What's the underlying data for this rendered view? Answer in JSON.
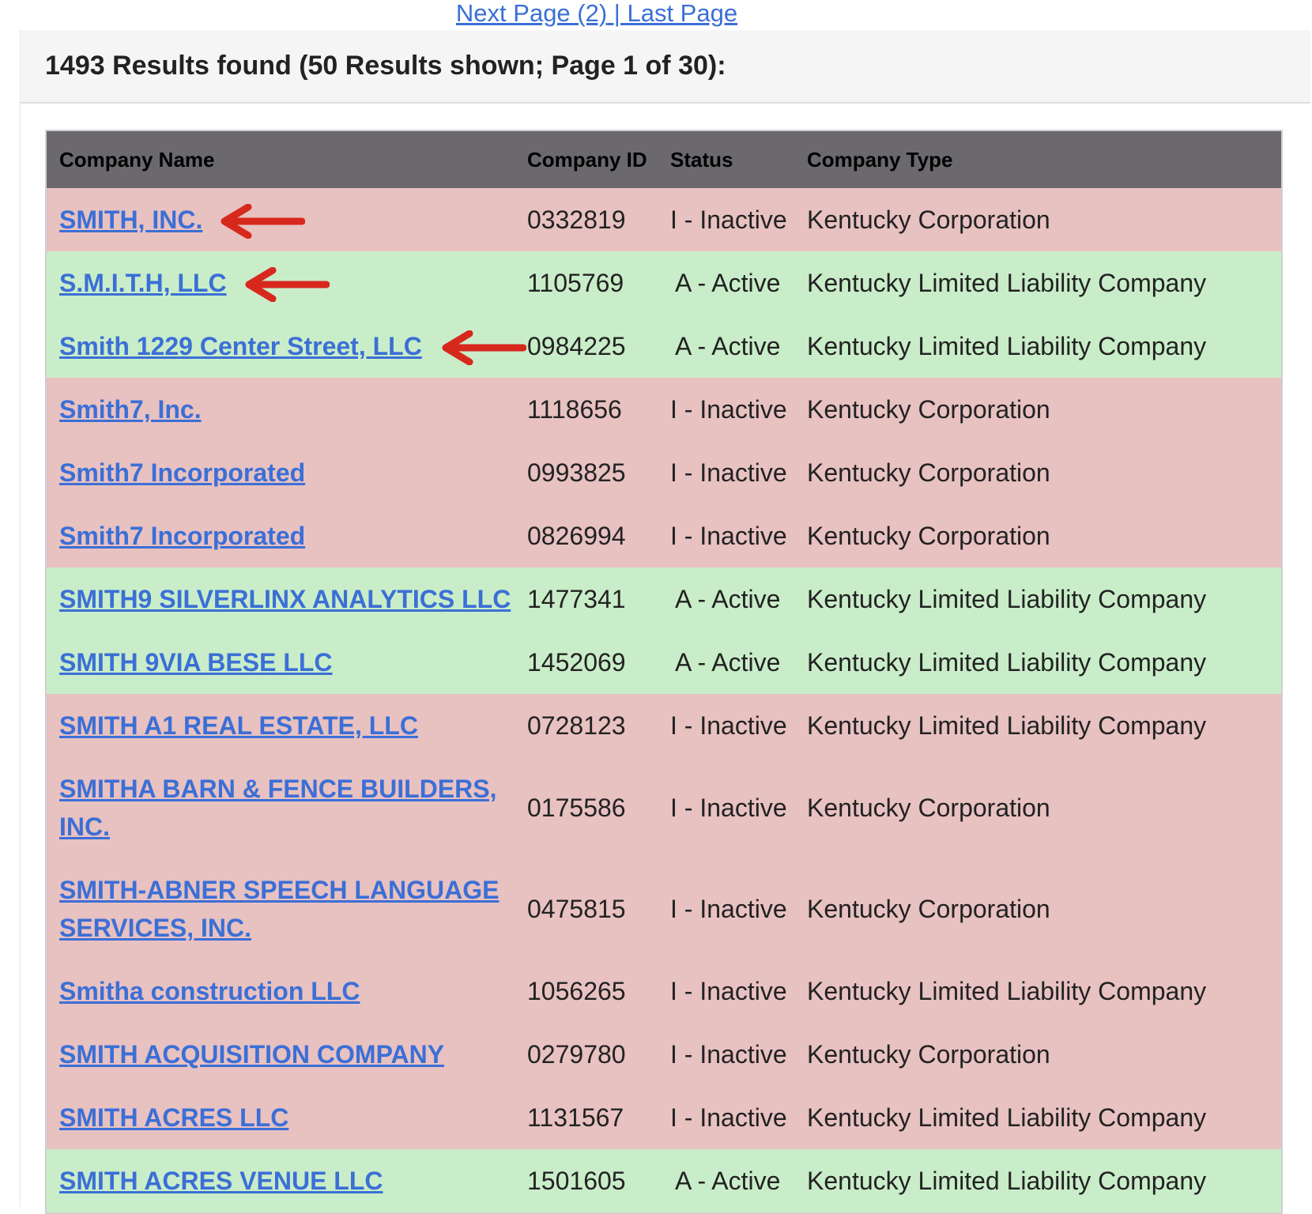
{
  "pager": {
    "next_label": "Next Page (2)",
    "separator": " | ",
    "last_label": "Last Page"
  },
  "results": {
    "summary": "1493 Results found (50 Results shown; Page 1 of 30):"
  },
  "table": {
    "headers": {
      "name": "Company Name",
      "id": "Company ID",
      "status": "Status",
      "type": "Company Type"
    },
    "rows": [
      {
        "name": "SMITH, INC.",
        "id": "0332819",
        "status": "I - Inactive",
        "type": "Kentucky Corporation"
      },
      {
        "name": "S.M.I.T.H, LLC",
        "id": "1105769",
        "status": "A - Active",
        "type": "Kentucky Limited Liability Company"
      },
      {
        "name": "Smith 1229 Center Street, LLC",
        "id": "0984225",
        "status": "A - Active",
        "type": "Kentucky Limited Liability Company"
      },
      {
        "name": "Smith7, Inc.",
        "id": "1118656",
        "status": "I - Inactive",
        "type": "Kentucky Corporation"
      },
      {
        "name": "Smith7 Incorporated",
        "id": "0993825",
        "status": "I - Inactive",
        "type": "Kentucky Corporation"
      },
      {
        "name": "Smith7 Incorporated",
        "id": "0826994",
        "status": "I - Inactive",
        "type": "Kentucky Corporation"
      },
      {
        "name": "SMITH9 SILVERLINX ANALYTICS LLC",
        "id": "1477341",
        "status": "A - Active",
        "type": "Kentucky Limited Liability Company"
      },
      {
        "name": "SMITH 9VIA BESE LLC",
        "id": "1452069",
        "status": "A - Active",
        "type": "Kentucky Limited Liability Company"
      },
      {
        "name": "SMITH A1 REAL ESTATE, LLC",
        "id": "0728123",
        "status": "I - Inactive",
        "type": "Kentucky Limited Liability Company"
      },
      {
        "name": "SMITHA BARN & FENCE BUILDERS, INC.",
        "id": "0175586",
        "status": "I - Inactive",
        "type": "Kentucky Corporation"
      },
      {
        "name": "SMITH-ABNER SPEECH LANGUAGE SERVICES, INC.",
        "id": "0475815",
        "status": "I - Inactive",
        "type": "Kentucky Corporation"
      },
      {
        "name": "Smitha construction LLC",
        "id": "1056265",
        "status": "I - Inactive",
        "type": "Kentucky Limited Liability Company"
      },
      {
        "name": "SMITH ACQUISITION COMPANY",
        "id": "0279780",
        "status": "I - Inactive",
        "type": "Kentucky Corporation"
      },
      {
        "name": "SMITH ACRES LLC",
        "id": "1131567",
        "status": "I - Inactive",
        "type": "Kentucky Limited Liability Company"
      },
      {
        "name": "SMITH ACRES VENUE LLC",
        "id": "1501605",
        "status": "A - Active",
        "type": "Kentucky Limited Liability Company"
      }
    ]
  },
  "colors": {
    "link": "#3b6fd6",
    "header_bg": "#6b696d",
    "inactive_row": "#e8c1c1",
    "active_row": "#c9edc9",
    "arrow": "#d7281e"
  },
  "annotations": {
    "arrow_icon": "left-arrow-icon"
  }
}
